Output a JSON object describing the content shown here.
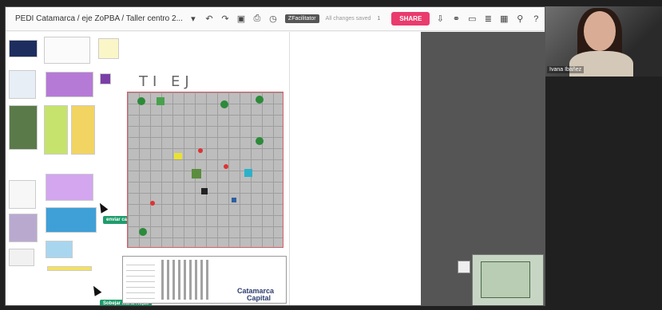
{
  "toolbar": {
    "board_title": "PEDI Catamarca / eje ZoPBA / Taller centro 2...",
    "badge": "ZFacilitator",
    "saved_status": "All changes saved",
    "user_count": "1",
    "share_label": "SHARE"
  },
  "canvas": {
    "sticky_note_1": "enviar calendar afiner",
    "sticky_note_2": "Sobejar Maria Rojas"
  },
  "logo": {
    "line1": "Catamarca",
    "line2": "Capital"
  },
  "map": {
    "label": "TI EJ"
  },
  "webcam": {
    "name": "Ivana Ibáñez"
  },
  "colors": {
    "share_button": "#ea3b6d",
    "map_border": "#d45d6a",
    "sticky_green": "#1f9d6c"
  }
}
